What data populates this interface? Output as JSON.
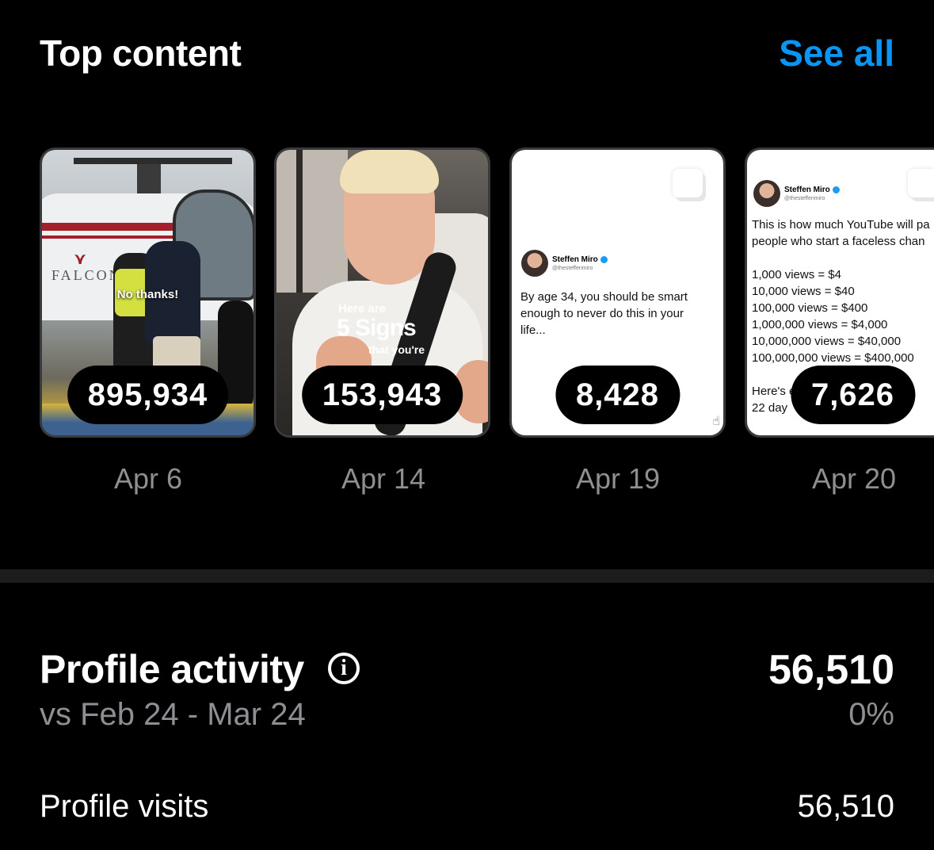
{
  "top_content": {
    "title": "Top content",
    "see_all_label": "See all",
    "items": [
      {
        "views": "895,934",
        "date": "Apr 6",
        "caption": "No thanks!",
        "logo_text": "FALCON"
      },
      {
        "views": "153,943",
        "date": "Apr 14",
        "caption_line1": "Here are",
        "caption_line2": "5 Signs",
        "caption_line3": "that you're"
      },
      {
        "views": "8,428",
        "date": "Apr 19",
        "author": "Steffen Miro",
        "handle": "@thesteffenmiro",
        "text": "By age 34, you should be smart\nenough to never do this in your\nlife..."
      },
      {
        "views": "7,626",
        "date": "Apr 20",
        "author": "Steffen Miro",
        "handle": "@thesteffenmiro",
        "text": "This is how much YouTube will pa\npeople who start a faceless chan\n\n1,000 views = $4\n10,000 views = $40\n100,000 views = $400\n1,000,000 views = $4,000\n10,000,000 views = $40,000\n100,000,000 views = $400,000\n\nHere's ex                    withi\n22 day                        ded"
      }
    ]
  },
  "profile_activity": {
    "title": "Profile activity",
    "comparison": "vs Feb 24 - Mar 24",
    "value": "56,510",
    "change": "0%"
  },
  "profile_visits": {
    "label": "Profile visits",
    "value": "56,510"
  },
  "colors": {
    "background": "#000000",
    "accent": "#0a95f5",
    "secondary_text": "#8e8e93",
    "divider": "#1c1c1e"
  },
  "icons": {
    "info": "info-circle-icon",
    "verified": "verified-badge-icon"
  }
}
